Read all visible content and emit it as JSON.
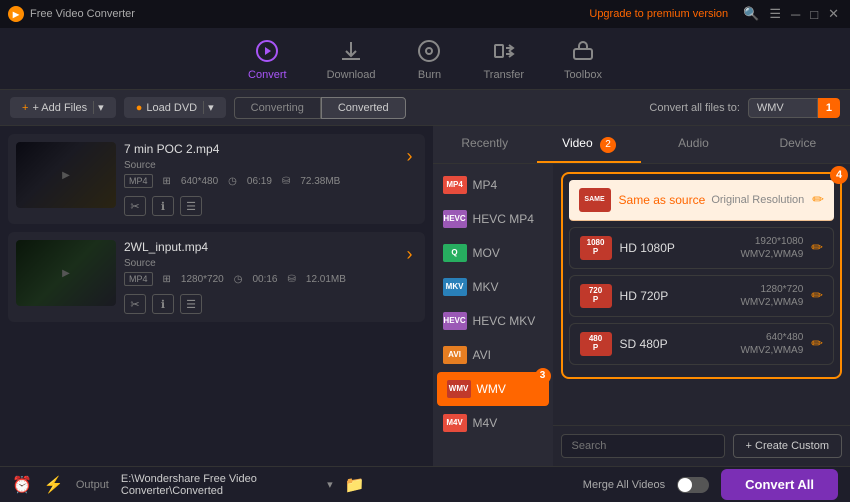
{
  "app": {
    "title": "Free Video Converter",
    "upgrade_link": "Upgrade to premium version"
  },
  "titlebar": {
    "close": "✕",
    "minimize": "─",
    "maximize": "□"
  },
  "navbar": {
    "items": [
      {
        "id": "convert",
        "label": "Convert",
        "active": true
      },
      {
        "id": "download",
        "label": "Download",
        "active": false
      },
      {
        "id": "burn",
        "label": "Burn",
        "active": false
      },
      {
        "id": "transfer",
        "label": "Transfer",
        "active": false
      },
      {
        "id": "toolbox",
        "label": "Toolbox",
        "active": false
      }
    ]
  },
  "toolbar": {
    "add_files": "+ Add Files",
    "load_dvd": "Load DVD",
    "tab_converting": "Converting",
    "tab_converted": "Converted",
    "convert_all_label": "Convert all files to:",
    "format_value": "WMV",
    "dropdown_number": "1"
  },
  "files": [
    {
      "id": "file1",
      "name": "7 min POC 2.mp4",
      "source_label": "Source",
      "format": "MP4",
      "resolution": "640*480",
      "duration": "06:19",
      "size": "72.38MB"
    },
    {
      "id": "file2",
      "name": "2WL_input.mp4",
      "source_label": "Source",
      "format": "MP4",
      "resolution": "1280*720",
      "duration": "00:16",
      "size": "12.01MB"
    }
  ],
  "format_panel": {
    "tabs": [
      {
        "id": "recently",
        "label": "Recently",
        "badge": ""
      },
      {
        "id": "video",
        "label": "Video",
        "badge": "2"
      },
      {
        "id": "audio",
        "label": "Audio",
        "badge": ""
      },
      {
        "id": "device",
        "label": "Device",
        "badge": ""
      }
    ],
    "active_tab": "video",
    "formats": [
      {
        "id": "mp4",
        "label": "MP4",
        "icon_class": "mp4",
        "icon_text": "MP4"
      },
      {
        "id": "hevc_mp4",
        "label": "HEVC MP4",
        "icon_class": "hevc",
        "icon_text": "HEVC"
      },
      {
        "id": "mov",
        "label": "MOV",
        "icon_class": "mov",
        "icon_text": "MOV"
      },
      {
        "id": "mkv",
        "label": "MKV",
        "icon_class": "mkv",
        "icon_text": "MKV"
      },
      {
        "id": "hevc_mkv",
        "label": "HEVC MKV",
        "icon_class": "hevc",
        "icon_text": "HEVC"
      },
      {
        "id": "avi",
        "label": "AVI",
        "icon_class": "avi",
        "icon_text": "AVI"
      },
      {
        "id": "wmv",
        "label": "WMV",
        "icon_class": "wmv",
        "icon_text": "WMV",
        "selected": true
      },
      {
        "id": "m4v",
        "label": "M4V",
        "icon_class": "mp4",
        "icon_text": "M4V"
      }
    ],
    "badge_number": "3",
    "resolutions": {
      "same_source": {
        "label": "Same as source",
        "spec": "Original Resolution",
        "is_selected": true
      },
      "items": [
        {
          "id": "hd1080",
          "name": "HD 1080P",
          "res": "1920*1080",
          "codec": "WMV2,WMA9"
        },
        {
          "id": "hd720",
          "name": "HD 720P",
          "res": "1280*720",
          "codec": "WMV2,WMA9"
        },
        {
          "id": "sd480",
          "name": "SD 480P",
          "res": "640*480",
          "codec": "WMV2,WMA9"
        }
      ],
      "badge_number": "4"
    },
    "create_custom": "+ Create Custom",
    "search_placeholder": "Search"
  },
  "bottombar": {
    "output_label": "Output",
    "output_path": "E:\\Wondershare Free Video Converter\\Converted",
    "merge_label": "Merge All Videos",
    "convert_all_btn": "Convert All"
  }
}
